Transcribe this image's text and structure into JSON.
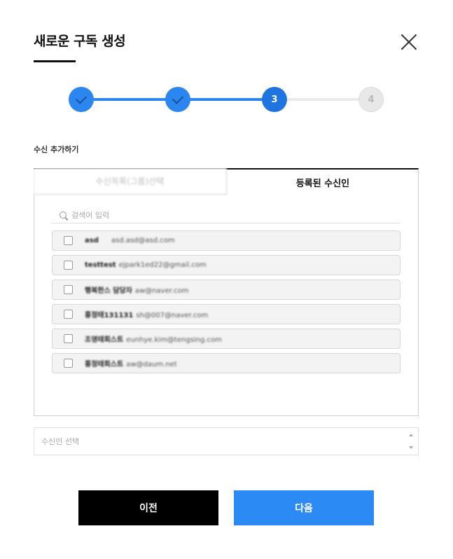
{
  "modal": {
    "title": "새로운 구독 생성"
  },
  "steps": [
    {
      "label": "",
      "state": "done"
    },
    {
      "label": "",
      "state": "done"
    },
    {
      "label": "3",
      "state": "active"
    },
    {
      "label": "4",
      "state": "todo"
    }
  ],
  "section_label": "수신 추가하기",
  "tabs": {
    "inactive_label": "수신목록(그룹)선택",
    "active_label": "등록된 수신인"
  },
  "search": {
    "placeholder": "검색어 입력"
  },
  "recipients": [
    {
      "name": "asd",
      "email": "asd.asd@asd.com"
    },
    {
      "name": "testtest",
      "email": "ejpark1ed22@gmail.com"
    },
    {
      "name": "행복한스 담당자",
      "email": "aw@naver.com"
    },
    {
      "name": "홍정태131131",
      "email": "sh@007@naver.com"
    },
    {
      "name": "조영태회스트",
      "email": "eunhye.kim@tengsing.com"
    },
    {
      "name": "홍정태회스트",
      "email": "aw@daum.net"
    }
  ],
  "select": {
    "placeholder": "수신인 선택"
  },
  "buttons": {
    "prev": "이전",
    "next": "다음"
  },
  "colors": {
    "primary": "#2b86f0",
    "dark": "#000000"
  }
}
